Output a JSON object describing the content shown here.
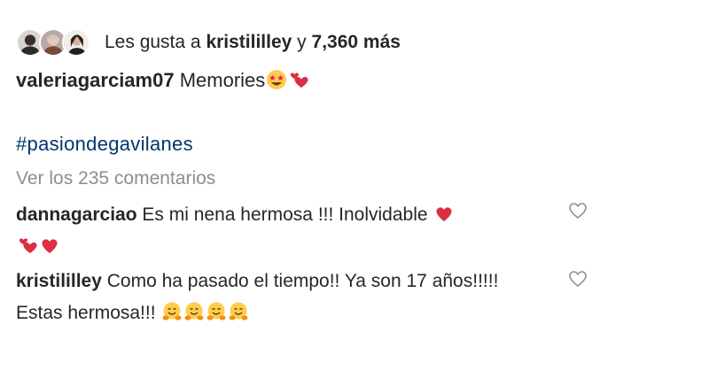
{
  "likes": {
    "prefix": "Les gusta a",
    "user": "kristililley",
    "connector": "y",
    "others": "7,360 más"
  },
  "caption": {
    "username": "valeriagarciam07",
    "text": "Memories",
    "emojis": [
      "star-struck-emoji",
      "two-hearts-emoji"
    ]
  },
  "hashtag": "#pasiondegavilanes",
  "view_all_comments": "Ver los 235 comentarios",
  "comments": [
    {
      "username": "dannagarciao",
      "text": "Es mi nena hermosa !!! Inolvidable",
      "emojis": [
        "red-heart-emoji",
        "two-hearts-emoji",
        "red-heart-emoji"
      ]
    },
    {
      "username": "kristililley",
      "text": "Como ha pasado el tiempo!! Ya son 17 años!!!!! Estas hermosa!!!",
      "emojis": [
        "hugging-face-emoji",
        "hugging-face-emoji",
        "hugging-face-emoji",
        "hugging-face-emoji"
      ]
    }
  ],
  "icons": {
    "like": "heart-outline-icon"
  },
  "colors": {
    "text": "#262626",
    "muted": "#8e8e8e",
    "hashtag": "#00376b",
    "heart_red": "#e0245e",
    "emoji_yellow": "#ffcc4d"
  }
}
